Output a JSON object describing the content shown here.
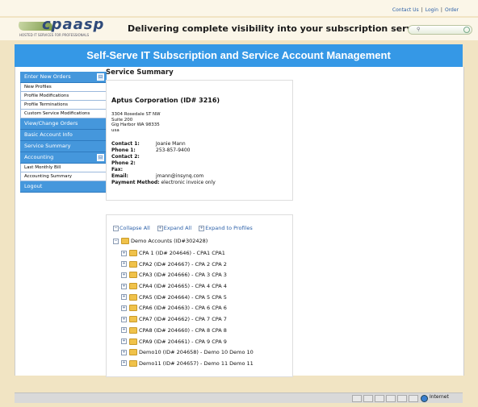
{
  "top_links": {
    "contact": "Contact Us",
    "login": "Login",
    "order": "Order"
  },
  "header": {
    "logo_text": "cpaasp",
    "logo_tagline": "HOSTED IT SERVICES FOR PROFESSIONALS",
    "tagline": "Delivering complete visibility into your subscription services",
    "search_placeholder": ""
  },
  "title": "Self-Serve IT Subscription and Service Account Management",
  "sidebar": {
    "items": [
      {
        "label": "Enter New Orders",
        "type": "head",
        "toggle": "⊟"
      },
      {
        "label": "New Profiles",
        "type": "sub"
      },
      {
        "label": "Profile Modifications",
        "type": "sub"
      },
      {
        "label": "Profile Terminations",
        "type": "sub"
      },
      {
        "label": "Custom Service Modifications",
        "type": "sub"
      },
      {
        "label": "View/Change Orders",
        "type": "head"
      },
      {
        "label": "Basic Account Info",
        "type": "head"
      },
      {
        "label": "Service Summary",
        "type": "head"
      },
      {
        "label": "Accounting",
        "type": "head",
        "toggle": "⊟"
      },
      {
        "label": "Last Monthly Bill",
        "type": "sub"
      },
      {
        "label": "Accounting Summary",
        "type": "sub"
      },
      {
        "label": "Logout",
        "type": "head"
      }
    ]
  },
  "main": {
    "title": "Service Summary",
    "company": "Aptus Corporation (ID# 3216)",
    "address": [
      "3304 Rosedale ST NW",
      "Suite 200",
      "Gig Harbor WA 98335",
      "usa"
    ],
    "contact1": {
      "label": "Contact 1:",
      "value": "Joanie Mann"
    },
    "phone1": {
      "label": "Phone 1:",
      "value": "253-857-9400"
    },
    "contact2": {
      "label": "Contact 2:",
      "value": ""
    },
    "phone2": {
      "label": "Phone 2:",
      "value": ""
    },
    "fax": {
      "label": "Fax:",
      "value": ""
    },
    "email": {
      "label": "Email:",
      "value": "jmann@insynq.com"
    },
    "payment": {
      "label": "Payment Method:",
      "value": "electronic invoice only"
    }
  },
  "tree": {
    "actions": {
      "collapse": "Collapse All",
      "expand": "Expand All",
      "expand_profiles": "Expand to Profiles"
    },
    "root": "Demo Accounts (ID#302428)",
    "nodes": [
      "CPA 1 (ID# 204646) - CPA1 CPA1",
      "CPA2 (ID# 204667) - CPA 2 CPA 2",
      "CPA3 (ID# 204666) - CPA 3 CPA 3",
      "CPA4 (ID# 204665) - CPA 4 CPA 4",
      "CPA5 (ID# 204664) - CPA 5 CPA 5",
      "CPA6 (ID# 204663) - CPA 6 CPA 6",
      "CPA7 (ID# 204662) - CPA 7 CPA 7",
      "CPA8 (ID# 204660) - CPA 8 CPA 8",
      "CPA9 (ID# 204661) - CPA 9 CPA 9",
      "Demo10 (ID# 204658) - Demo 10 Demo 10",
      "Demo11 (ID# 204657) - Demo 11 Demo 11"
    ],
    "expand_glyph": "⊞",
    "collapse_glyph": "⊟"
  },
  "status_bar": {
    "zone": "Internet"
  },
  "colors": {
    "title_band": "#3598e6",
    "sidebar_head": "#4597dc",
    "link": "#2a5fa8"
  }
}
